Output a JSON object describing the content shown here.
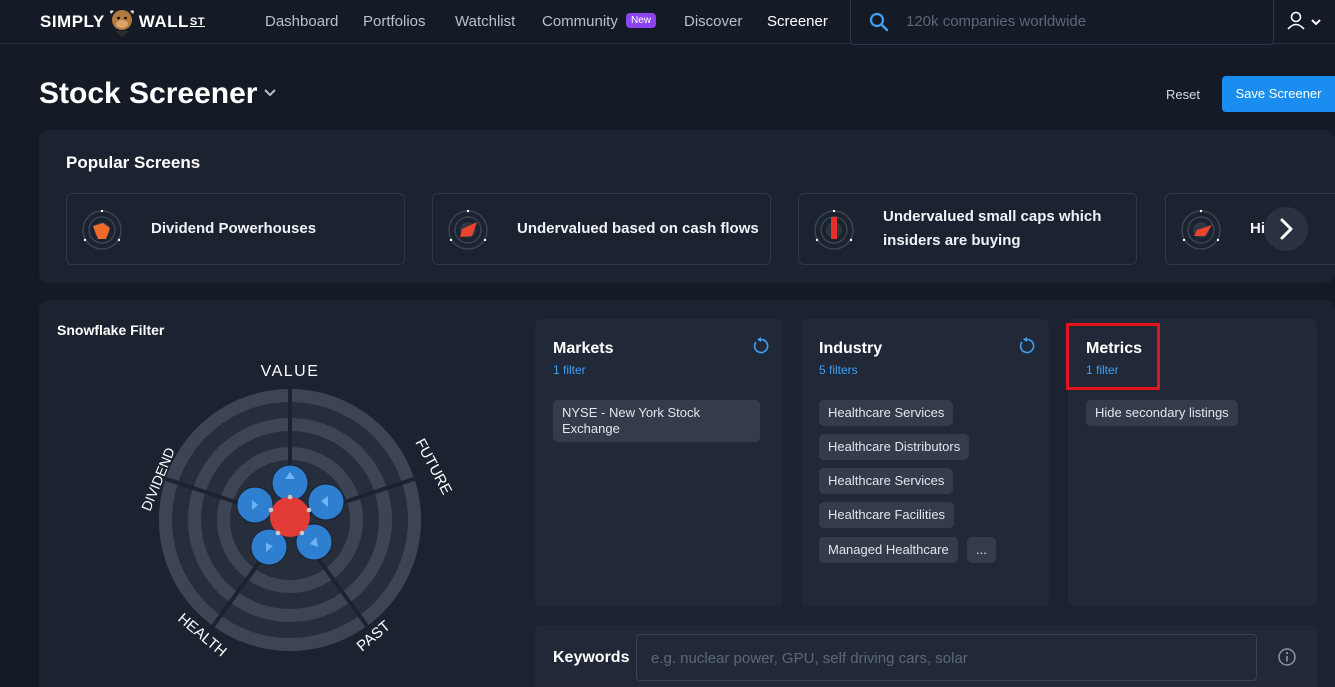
{
  "nav": {
    "logo_left": "SIMPLY",
    "logo_right": "WALL",
    "logo_st": "ST",
    "links": [
      "Dashboard",
      "Portfolios",
      "Watchlist",
      "Community",
      "Discover",
      "Screener"
    ],
    "new_badge": "New",
    "search_placeholder": "120k companies worldwide"
  },
  "header": {
    "title": "Stock Screener",
    "reset": "Reset",
    "save": "Save Screener"
  },
  "popular": {
    "title": "Popular Screens",
    "cards": [
      {
        "label": "Dividend Powerhouses"
      },
      {
        "label": "Undervalued based on cash flows"
      },
      {
        "label_line1": "Undervalued small caps which",
        "label_line2": "insiders are buying"
      },
      {
        "label": "Hi"
      }
    ]
  },
  "snowflake": {
    "title": "Snowflake Filter",
    "axes": [
      "VALUE",
      "FUTURE",
      "PAST",
      "HEALTH",
      "DIVIDEND"
    ]
  },
  "filters": {
    "markets": {
      "name": "Markets",
      "count": "1 filter",
      "chips": [
        "NYSE - New York Stock",
        "Exchange"
      ]
    },
    "industry": {
      "name": "Industry",
      "count": "5 filters",
      "chips": [
        "Healthcare Services",
        "Healthcare Distributors",
        "Healthcare Services",
        "Healthcare Facilities",
        "Managed Healthcare",
        "..."
      ]
    },
    "metrics": {
      "name": "Metrics",
      "count": "1 filter",
      "chips": [
        "Hide secondary listings"
      ]
    }
  },
  "keywords": {
    "label": "Keywords",
    "placeholder": "e.g. nuclear power, GPU, self driving cars, solar"
  },
  "colors": {
    "accent": "#1a8ef0",
    "badge": "#8b44f0",
    "highlight": "#e3141e"
  }
}
